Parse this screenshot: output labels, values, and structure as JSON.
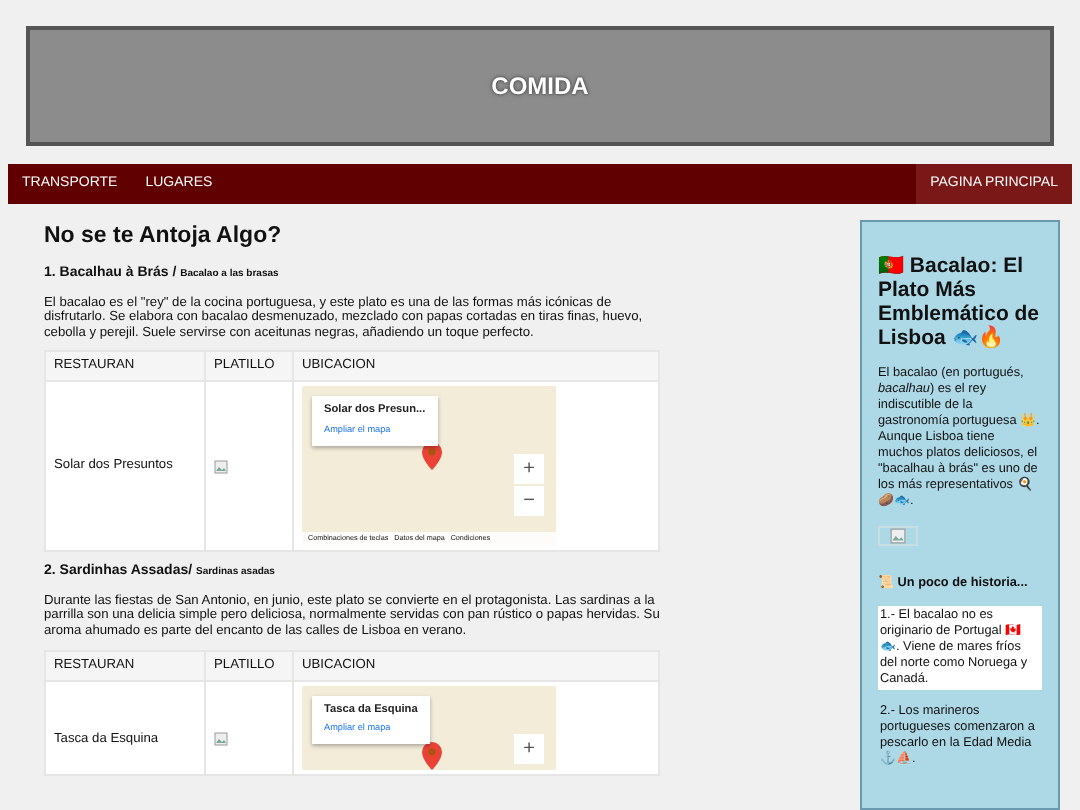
{
  "header": {
    "title": "COMIDA"
  },
  "nav": {
    "items": [
      {
        "label": "TRANSPORTE",
        "selected": false
      },
      {
        "label": "LUGARES",
        "selected": false
      }
    ],
    "home": {
      "label": "PAGINA PRINCIPAL",
      "selected": true
    }
  },
  "main": {
    "title": "No se te Antoja Algo?",
    "dishes": [
      {
        "name": "1. Bacalhau à Brás / ",
        "subtitle": "Bacalao a las brasas",
        "description": "El bacalao es el \"rey\" de la cocina portuguesa, y este plato es una de las formas más icónicas de disfrutarlo. Se elabora con bacalao desmenuzado, mezclado con papas cortadas en tiras finas, huevo, cebolla y perejil. Suele servirse con aceitunas negras, añadiendo un toque perfecto.",
        "columns": [
          "RESTAURAN",
          "PLATILLO",
          "UBICACION"
        ],
        "restaurant": "Solar dos Presuntos",
        "map": {
          "place": "Solar dos Presun...",
          "link": "Ampliar el mapa",
          "zoom_in": "+",
          "zoom_out": "−",
          "footer": [
            "Combinaciones de teclas",
            "Datos del mapa",
            "Condiciones"
          ]
        }
      },
      {
        "name": "2. Sardinhas Assadas/ ",
        "subtitle": "Sardinas asadas",
        "description": "Durante las fiestas de San Antonio, en junio, este plato se convierte en el protagonista. Las sardinas a la parrilla son una delicia simple pero deliciosa, normalmente servidas con pan rústico o papas hervidas. Su aroma ahumado es parte del encanto de las calles de Lisboa en verano.",
        "columns": [
          "RESTAURAN",
          "PLATILLO",
          "UBICACION"
        ],
        "restaurant": "Tasca da Esquina",
        "map": {
          "place": "Tasca da Esquina",
          "link": "Ampliar el mapa",
          "zoom_in": "+"
        }
      }
    ]
  },
  "sidebar": {
    "title": "🇵🇹 Bacalao: El Plato Más Emblemático de Lisboa 🐟🔥",
    "intro": "El bacalao (en portugués, *bacalhau*) es el rey indiscutible de la gastronomía portuguesa 👑. Aunque Lisboa tiene muchos platos deliciosos, el \"bacalhau à brás\" es uno de los más representativos 🍳🥔🐟.",
    "history_title": "📜 Un poco de historia...",
    "facts": [
      {
        "text": "1.- El bacalao no es originario de Portugal 🇨🇦🐟. Viene de mares fríos del norte como Noruega y Canadá.",
        "highlighted": true
      },
      {
        "text": "2.- Los marineros portugueses comenzaron a pescarlo en la Edad Media ⚓⛵.",
        "highlighted": false
      }
    ]
  }
}
